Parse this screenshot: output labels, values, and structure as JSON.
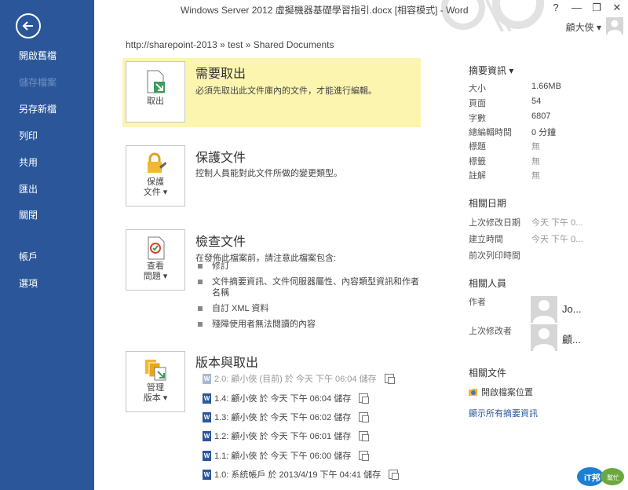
{
  "window": {
    "title": "Windows Server 2012 虛擬機器基礎學習指引.docx [相容模式] - Word",
    "controls": [
      "?",
      "—",
      "❐",
      "✕"
    ],
    "user_name": "顧大俠 ▾"
  },
  "sidebar": {
    "items": [
      {
        "label": "開啟舊檔"
      },
      {
        "label": "儲存檔案"
      },
      {
        "label": "另存新檔"
      },
      {
        "label": "列印"
      },
      {
        "label": "共用"
      },
      {
        "label": "匯出"
      },
      {
        "label": "關閉"
      },
      {
        "label": "帳戶"
      },
      {
        "label": "選項"
      }
    ]
  },
  "breadcrumb": "http://sharepoint-2013 » test » Shared Documents",
  "sections": {
    "checkout": {
      "button_label": "取出",
      "title": "需要取出",
      "desc": "必須先取出此文件庫內的文件，才能進行編輯。"
    },
    "protect": {
      "button_line1": "保護",
      "button_line2": "文件 ▾",
      "title": "保護文件",
      "desc": "控制人員能對此文件所做的變更類型。"
    },
    "inspect": {
      "button_line1": "查看",
      "button_line2": "問題 ▾",
      "title": "檢查文件",
      "desc": "在發佈此檔案前，請注意此檔案包含:",
      "bullets": [
        "修訂",
        "文件摘要資訊、文件伺服器屬性、內容類型資訊和作者",
        "名稱",
        "自訂 XML 資料",
        "殘障使用者無法閱讀的內容"
      ]
    },
    "versions": {
      "button_line1": "管理",
      "button_line2": "版本 ▾",
      "title": "版本與取出",
      "rows": [
        "2.0: 顧小俠 (目前) 於 今天 下午 06:04 儲存",
        "1.4: 顧小俠 於 今天 下午 06:04 儲存",
        "1.3: 顧小俠 於 今天 下午 06:02 儲存",
        "1.2: 顧小俠 於 今天 下午 06:01 儲存",
        "1.1: 顧小俠 於 今天 下午 06:00 儲存",
        "1.0: 系統帳戶 於 2013/4/19 下午 04:41 儲存"
      ]
    }
  },
  "properties": {
    "header": "摘要資訊 ▾",
    "items": [
      {
        "label": "大小",
        "value": "1.66MB"
      },
      {
        "label": "頁面",
        "value": "54"
      },
      {
        "label": "字數",
        "value": "6807"
      },
      {
        "label": "總編輯時間",
        "value": "0 分鐘"
      },
      {
        "label": "標題",
        "value": "無"
      },
      {
        "label": "標籤",
        "value": "無"
      },
      {
        "label": "註解",
        "value": "無"
      }
    ],
    "dates_header": "相關日期",
    "dates": [
      {
        "label": "上次修改日期",
        "value": "今天 下午 0..."
      },
      {
        "label": "建立時間",
        "value": "今天 下午 0..."
      },
      {
        "label": "前次列印時間",
        "value": ""
      }
    ],
    "people_header": "相關人員",
    "author_label": "作者",
    "author_name": "Jo...",
    "modifier_label": "上次修改者",
    "modifier_name": "顧...",
    "docs_header": "相關文件",
    "open_location": "開啟檔案位置",
    "show_all": "顯示所有摘要資訊"
  },
  "watermark": {
    "line1": "iT邦",
    "line2": "幫忙"
  },
  "colors": {
    "sidebar": "#2b579a",
    "highlight": "#fcf5b0",
    "accent": "#2b579a"
  }
}
